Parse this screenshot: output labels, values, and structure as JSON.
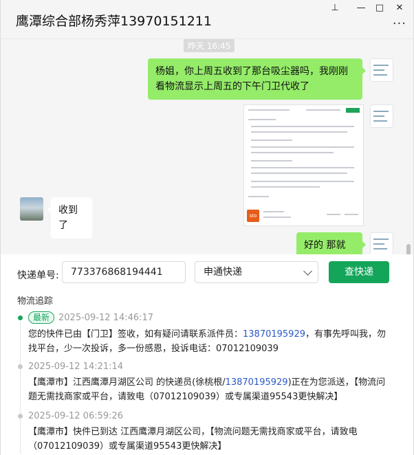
{
  "window": {
    "title": "鹰潭综合部杨秀萍13970151211",
    "controls": {
      "pin": "⊥",
      "minimize": "—",
      "maximize": "□",
      "close": "✕"
    },
    "more": "···"
  },
  "chat": {
    "timestamp": "昨天 16:45",
    "messages": [
      {
        "sender": "me",
        "type": "text",
        "text": "杨姐，你上周五收到了那台吸尘器吗，我刚刚看物流显示上周五的下午门卫代收了"
      },
      {
        "sender": "me",
        "type": "image",
        "alt": "快递查询截图"
      },
      {
        "sender": "other",
        "type": "text",
        "text": "收到了"
      },
      {
        "sender": "me",
        "type": "text",
        "text": "好的  那就行"
      }
    ]
  },
  "tracking": {
    "label": "快递单号:",
    "number": "773376868194441",
    "carrier": "申通快递",
    "query_button": "查快递",
    "section_title": "物流追踪",
    "latest_badge": "最新",
    "events": [
      {
        "time": "2025-09-12 14:46:17",
        "parts": [
          "您的快件已由【门卫】签收，如有疑问请联系派件员：",
          "13870195929",
          "，有事先呼叫我，勿找平台，少一次投诉，多一份感恩，投诉电话：07012109039"
        ]
      },
      {
        "time": "2025-09-12 14:21:14",
        "parts": [
          "【鹰潭市】江西鹰潭月湖区公司 的快递员(徐桃根/",
          "13870195929",
          ")正在为您派送，【物流问题无需找商家或平台，请致电（07012109039）或专属渠道95543更快解决】"
        ]
      },
      {
        "time": "2025-09-12 06:59:26",
        "parts": [
          "【鹰潭市】快件已到达 江西鹰潭月湖区公司，【物流问题无需找商家或平台，请致电（07012109039）或专属渠道95543更快解决】"
        ]
      }
    ]
  },
  "colors": {
    "accent": "#13a55a",
    "bubble_me": "#95ec69",
    "link": "#2a57c7"
  }
}
